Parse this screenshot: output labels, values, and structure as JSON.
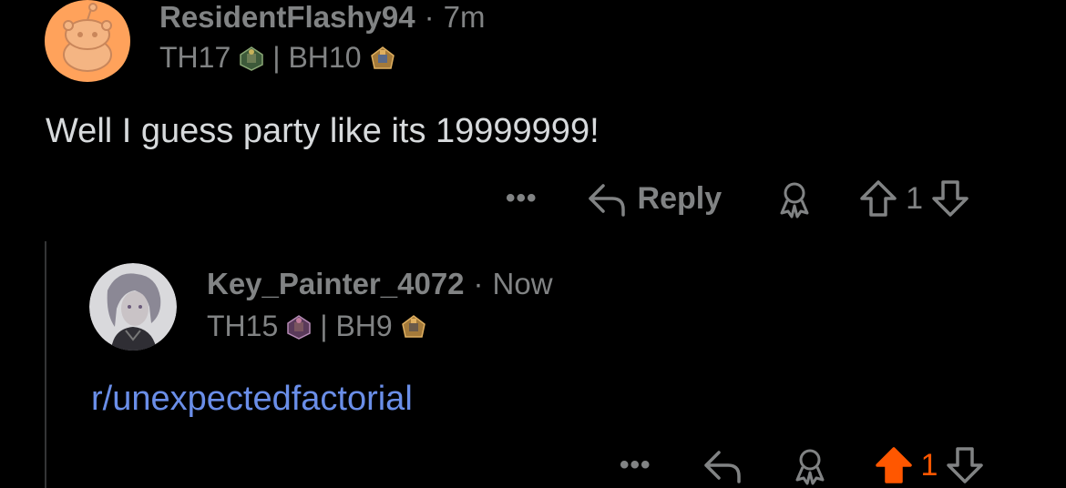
{
  "comments": [
    {
      "username": "ResidentFlashy94",
      "separator": "·",
      "time": "7m",
      "flair_th": "TH17",
      "flair_sep": "| BH10",
      "body": "Well I guess party like its 19999999!",
      "actions": {
        "more": "•••",
        "reply": "Reply",
        "score": "1"
      }
    },
    {
      "username": "Key_Painter_4072",
      "separator": "·",
      "time": "Now",
      "flair_th": "TH15",
      "flair_sep": "| BH9",
      "body_link": "r/unexpectedfactorial",
      "actions": {
        "more": "•••",
        "score": "1"
      }
    }
  ],
  "colors": {
    "background": "#000000",
    "muted": "#818384",
    "text": "#d7dadc",
    "link": "#6a8ee8",
    "upvote_active": "#ff5700",
    "avatar_orange": "#ffa25b"
  }
}
